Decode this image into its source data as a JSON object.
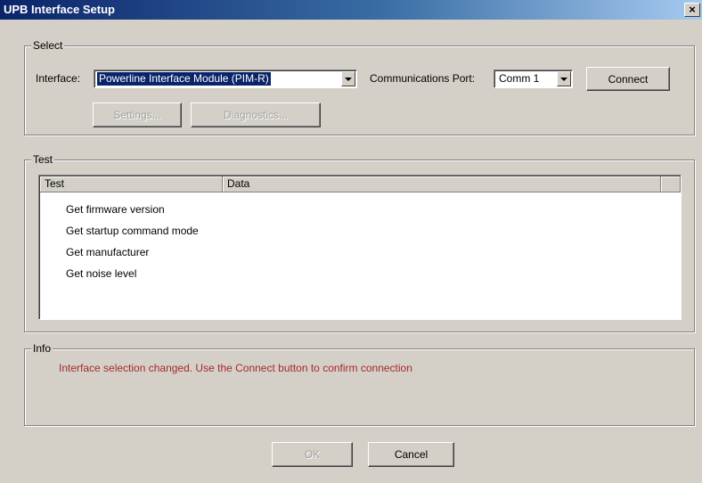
{
  "window": {
    "title": "UPB Interface Setup",
    "close_glyph": "×"
  },
  "select_group": {
    "label": "Select",
    "interface_label": "Interface:",
    "interface_value": "Powerline Interface Module (PIM-R)",
    "comm_port_label": "Communications Port:",
    "comm_port_value": "Comm 1",
    "connect_label": "Connect",
    "settings_label": "Settings...",
    "diagnostics_label": "Diagnostics..."
  },
  "test_group": {
    "label": "Test",
    "columns": [
      "Test",
      "Data"
    ],
    "rows": [
      "Get firmware version",
      "Get startup command mode",
      "Get manufacturer",
      "Get noise level"
    ]
  },
  "info_group": {
    "label": "Info",
    "message": "Interface selection changed.  Use the Connect button to confirm connection"
  },
  "footer": {
    "ok_label": "OK",
    "cancel_label": "Cancel"
  },
  "colors": {
    "dialog_bg": "#d4d0c8",
    "title_gradient_start": "#0a246a",
    "title_gradient_end": "#a6caf0",
    "selection": "#0a246a",
    "info_text": "#a52a2a"
  },
  "icons": {
    "close": "close-icon",
    "dropdown": "chevron-down-icon"
  }
}
